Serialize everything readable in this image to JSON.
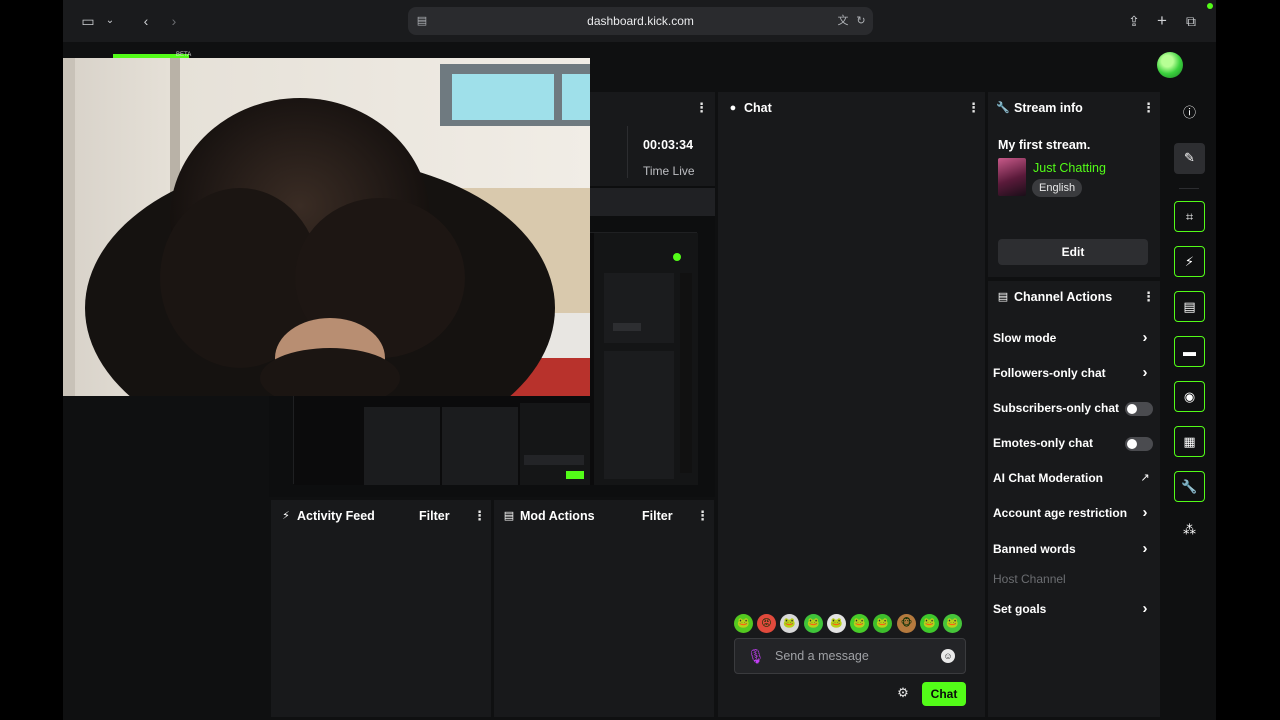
{
  "browser": {
    "url": "dashboard.kick.com",
    "icons": [
      "sidebar-icon",
      "chevron-down-icon",
      "back-icon",
      "forward-icon",
      "share-icon",
      "new-tab-icon",
      "tabs-icon",
      "reader-icon",
      "translate-icon",
      "reload-icon"
    ]
  },
  "header": {
    "beta_label": "BETA"
  },
  "video": {
    "time_value": "00:03:34",
    "time_label": "Time Live"
  },
  "chat": {
    "title": "Chat",
    "placeholder": "Send a message",
    "send_label": "Chat",
    "emotes": [
      "🐸",
      "😡",
      "🐸",
      "🐸",
      "🐸",
      "🐸",
      "🐸",
      "🐵",
      "🐸",
      "🐸"
    ]
  },
  "stream_info": {
    "title": "Stream info",
    "stream_title": "My first stream.",
    "category": "Just Chatting",
    "language_tag": "English",
    "edit_label": "Edit"
  },
  "channel_actions": {
    "title": "Channel Actions",
    "items": [
      {
        "label": "Slow mode",
        "control": "chevron"
      },
      {
        "label": "Followers-only chat",
        "control": "chevron"
      },
      {
        "label": "Subscribers-only chat",
        "control": "toggle",
        "on": false
      },
      {
        "label": "Emotes-only chat",
        "control": "toggle",
        "on": false
      },
      {
        "label": "AI Chat Moderation",
        "control": "external"
      },
      {
        "label": "Account age restriction",
        "control": "chevron"
      },
      {
        "label": "Banned words",
        "control": "chevron"
      },
      {
        "label": "Host Channel",
        "control": "none",
        "disabled": true
      },
      {
        "label": "Set goals",
        "control": "chevron"
      }
    ]
  },
  "activity_feed": {
    "title": "Activity Feed",
    "filter_label": "Filter"
  },
  "mod_actions": {
    "title": "Mod Actions",
    "filter_label": "Filter"
  },
  "rail": {
    "buttons": [
      "info-icon",
      "pencil-icon",
      "scan-icon",
      "bolt-icon",
      "document-icon",
      "chat-bubble-icon",
      "broadcast-icon",
      "layout-icon",
      "wrench-icon",
      "connections-icon"
    ]
  },
  "colors": {
    "accent": "#53fc18",
    "panel": "#18191b",
    "background": "#0f1011"
  }
}
